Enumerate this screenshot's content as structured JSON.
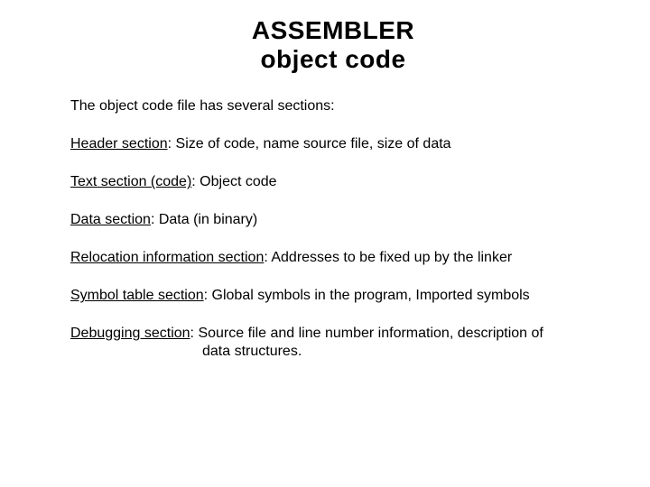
{
  "title_line1": "ASSEMBLER",
  "title_line2": "object code",
  "intro": "The object code file has several sections:",
  "sections": {
    "header": {
      "label": "Header section",
      "desc": ": Size of code, name source file, size of data"
    },
    "text": {
      "label": "Text section (code)",
      "desc": ": Object code"
    },
    "data": {
      "label": "Data section",
      "desc": ": Data (in binary)"
    },
    "reloc": {
      "label": "Relocation information section",
      "desc": ": Addresses to be fixed up by the linker"
    },
    "symtab": {
      "label": "Symbol table section",
      "desc": ": Global symbols in the program, Imported symbols"
    },
    "debug": {
      "label": "Debugging section",
      "desc": ": Source file and line number information, description of",
      "desc2": "data structures."
    }
  }
}
